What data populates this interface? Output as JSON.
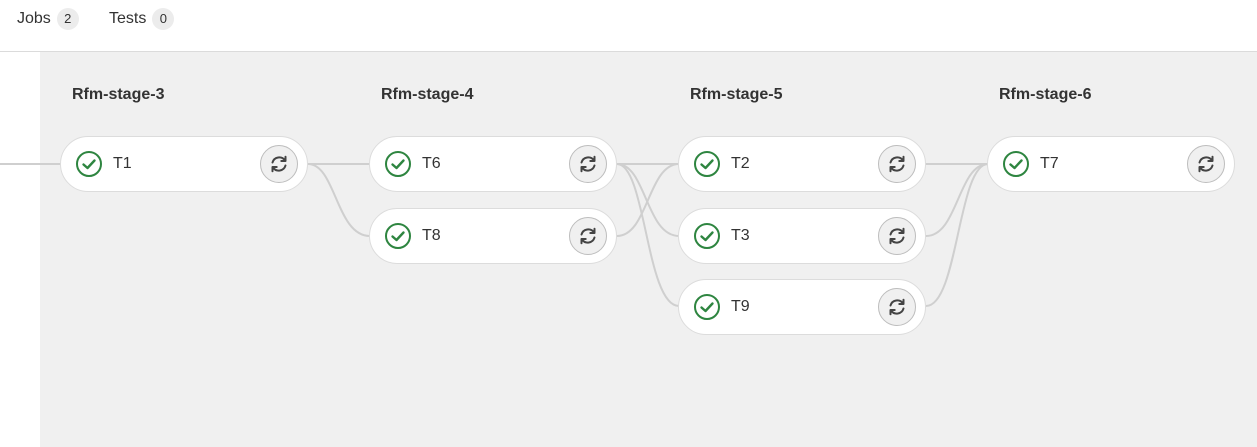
{
  "tabs": [
    {
      "label": "Jobs",
      "count": "2"
    },
    {
      "label": "Tests",
      "count": "0"
    }
  ],
  "stages": [
    {
      "title": "Rfm-stage-3"
    },
    {
      "title": "Rfm-stage-4"
    },
    {
      "title": "Rfm-stage-5"
    },
    {
      "title": "Rfm-stage-6"
    }
  ],
  "jobs": {
    "t1": {
      "name": "T1",
      "status": "passed"
    },
    "t6": {
      "name": "T6",
      "status": "passed"
    },
    "t8": {
      "name": "T8",
      "status": "passed"
    },
    "t2": {
      "name": "T2",
      "status": "passed"
    },
    "t3": {
      "name": "T3",
      "status": "passed"
    },
    "t9": {
      "name": "T9",
      "status": "passed"
    },
    "t7": {
      "name": "T7",
      "status": "passed"
    }
  },
  "colors": {
    "success": "#2e8540",
    "link": "#cfcfcf",
    "background": "#f0f0f0"
  },
  "icons": {
    "status": "check-circle-icon",
    "retry": "retry-icon"
  }
}
